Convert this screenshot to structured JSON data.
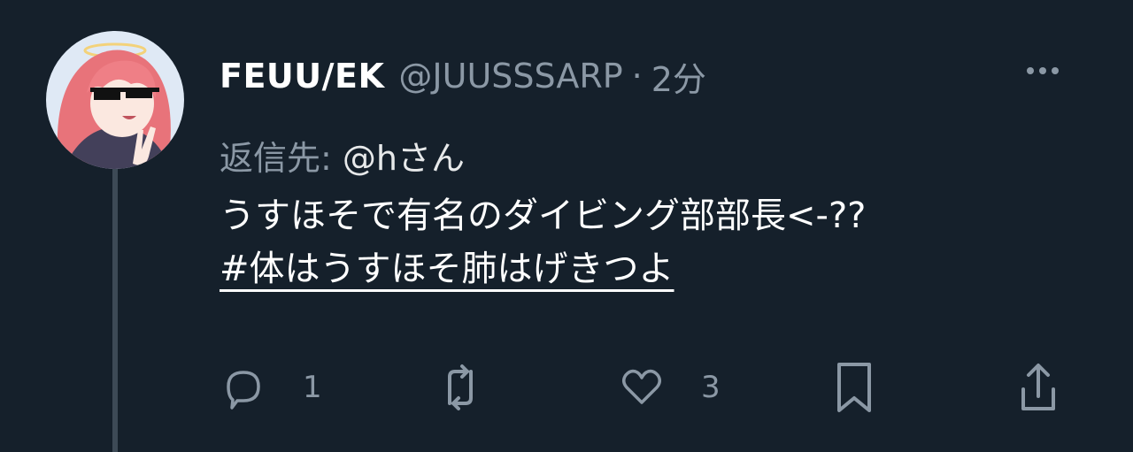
{
  "tweet": {
    "display_name": "FEUU/EK",
    "handle": "@JUUSSSARP",
    "separator": "·",
    "time": "2分",
    "reply_prefix": "返信先:",
    "reply_mention": "@hさん",
    "text_line1": "うすほそで有名のダイビング部部長<-??",
    "hashtag": "#体はうすほそ肺はげきつよ"
  },
  "actions": {
    "reply_count": "1",
    "like_count": "3"
  },
  "icons": [
    "avatar",
    "more-icon",
    "reply-icon",
    "retweet-icon",
    "like-icon",
    "bookmark-icon",
    "share-icon"
  ],
  "colors": {
    "background": "#15202b",
    "primary_text": "#ffffff",
    "secondary_text": "#8b98a5",
    "thread_line": "#3d4a56"
  }
}
